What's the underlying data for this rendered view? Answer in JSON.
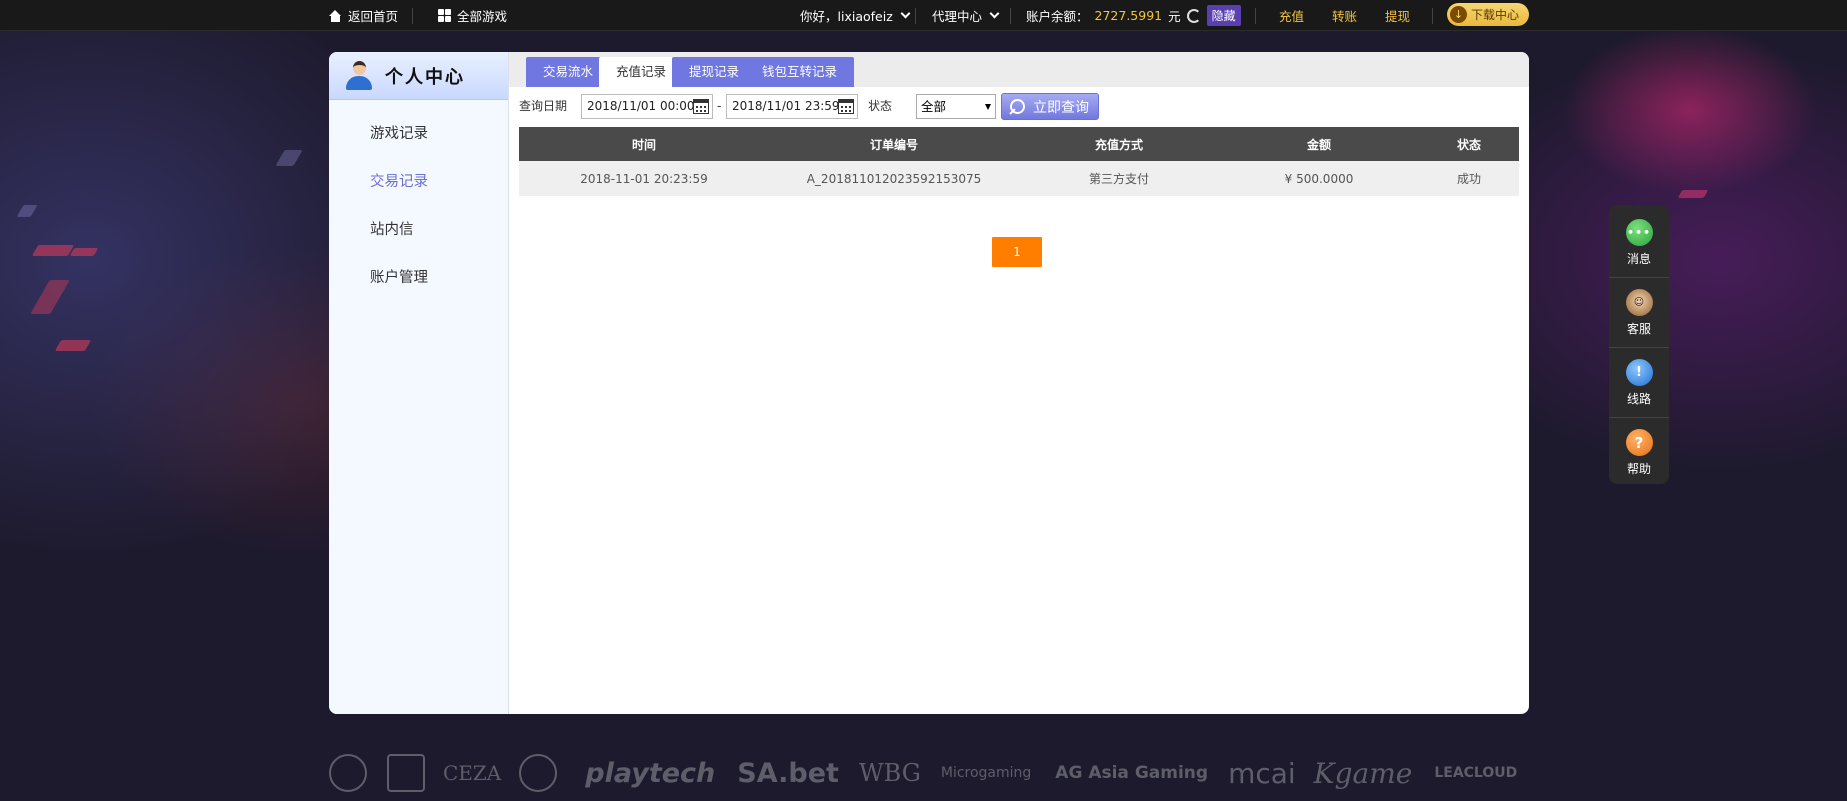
{
  "topbar": {
    "home_label": "返回首页",
    "all_games_label": "全部游戏",
    "greeting": "你好，lixiaofeiz",
    "agent_center": "代理中心",
    "balance_label": "账户余额：",
    "balance_value": "2727.5991",
    "balance_unit": "元",
    "hide_label": "隐藏",
    "recharge": "充值",
    "transfer": "转账",
    "withdraw": "提现",
    "download": "下载中心"
  },
  "sidebar": {
    "title": "个人中心",
    "items": [
      {
        "label": "游戏记录",
        "active": false
      },
      {
        "label": "交易记录",
        "active": true
      },
      {
        "label": "站内信",
        "active": false
      },
      {
        "label": "账户管理",
        "active": false
      }
    ]
  },
  "tabs": [
    {
      "label": "交易流水",
      "active": false
    },
    {
      "label": "充值记录",
      "active": true
    },
    {
      "label": "提现记录",
      "active": false
    },
    {
      "label": "钱包互转记录",
      "active": false
    }
  ],
  "filters": {
    "date_label": "查询日期",
    "start": "2018/11/01 00:00",
    "dash": "-",
    "end": "2018/11/01 23:59",
    "status_label": "状态",
    "status_value": "全部",
    "query_button": "立即查询"
  },
  "table": {
    "headers": [
      "时间",
      "订单编号",
      "充值方式",
      "金额",
      "状态"
    ],
    "rows": [
      [
        "2018-11-01 20:23:59",
        "A_201811012023592153075",
        "第三方支付",
        "¥ 500.0000",
        "成功"
      ]
    ]
  },
  "pagination": {
    "current": "1"
  },
  "float_panel": [
    {
      "label": "消息",
      "icon": "message-icon"
    },
    {
      "label": "客服",
      "icon": "customer-service-icon"
    },
    {
      "label": "线路",
      "icon": "route-icon"
    },
    {
      "label": "帮助",
      "icon": "help-icon"
    }
  ],
  "logos": [
    "CEZA",
    "playtech",
    "SA.bet",
    "WBG",
    "Microgaming",
    "AG Asia Gaming",
    "mcai",
    "Kgame",
    "LEACLOUD"
  ],
  "colors": {
    "accent": "#7177e0",
    "gold": "#f4c43a",
    "pager": "#ff7e00",
    "table_header": "#4a4a4a"
  }
}
